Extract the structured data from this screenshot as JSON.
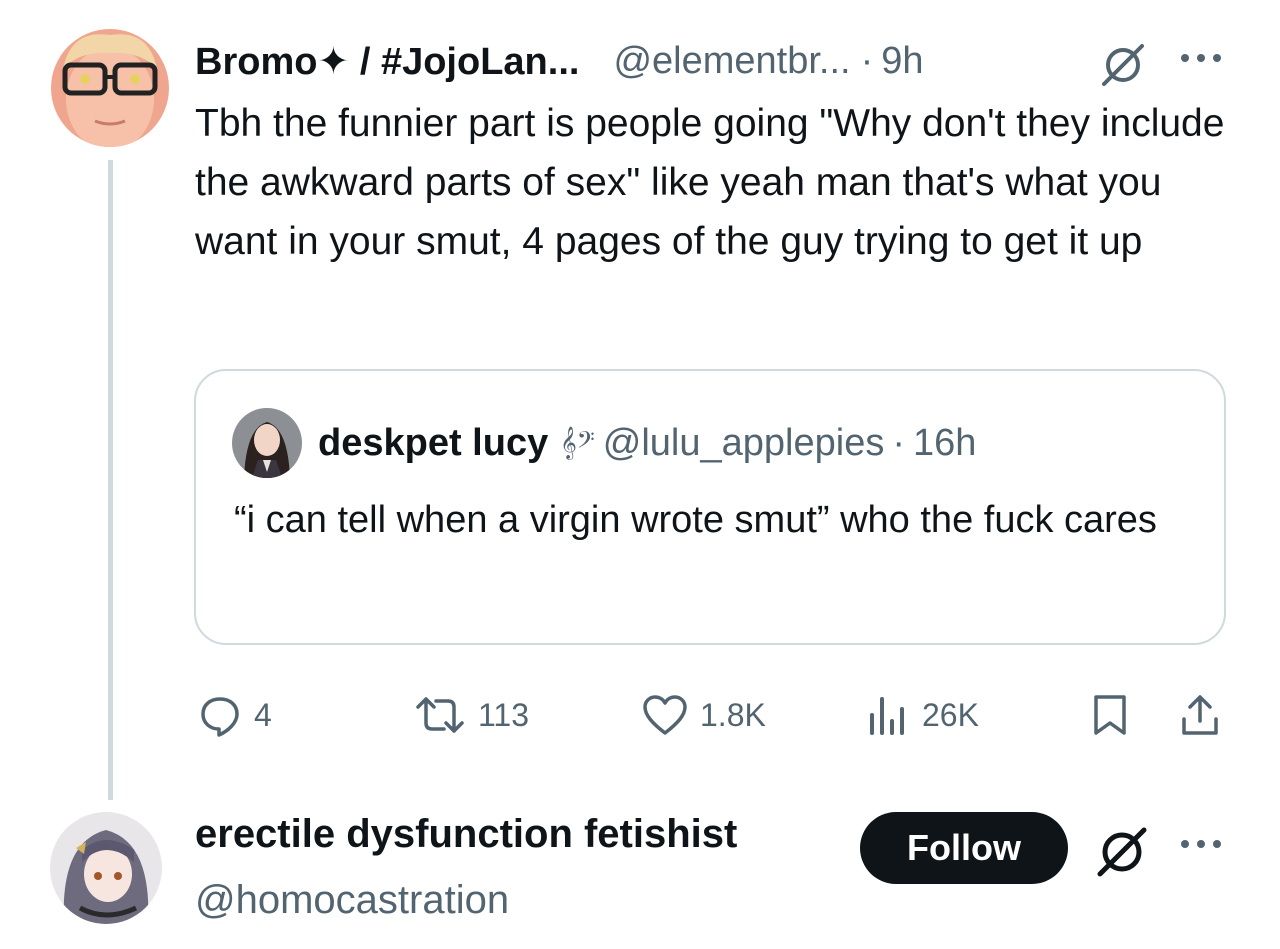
{
  "tweet": {
    "author_name": "Bromo✦ / #JojoLan...",
    "author_handle": "@elementbr...",
    "separator": "·",
    "time": "9h",
    "text": "Tbh the funnier part is people going \"Why don't they include the awkward parts of sex\" like yeah man that's what you want in your smut, 4 pages of the guy trying to get it up"
  },
  "quote": {
    "author_name": "deskpet lucy",
    "decoration": "𝄞𝄢",
    "author_handle": "@lulu_applepies",
    "separator": "·",
    "time": "16h",
    "text": "“i can tell when a virgin wrote smut” who the fuck cares"
  },
  "actions": {
    "replies": "4",
    "reposts": "113",
    "likes": "1.8K",
    "views": "26K"
  },
  "next_post": {
    "author_name": "erectile dysfunction fetishist",
    "author_handle": "@homocastration",
    "follow_label": "Follow"
  },
  "icons": {
    "reply": "reply-icon",
    "repost": "repost-icon",
    "like": "heart-icon",
    "views": "views-icon",
    "bookmark": "bookmark-icon",
    "share": "share-icon",
    "grok": "grok-icon",
    "more": "more-icon"
  },
  "colors": {
    "text": "#0f1419",
    "secondary": "#536471",
    "border": "#cfd9de",
    "follow_bg": "#0f1419"
  }
}
